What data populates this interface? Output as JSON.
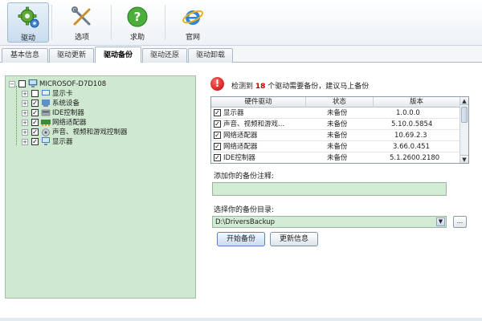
{
  "toolbar": {
    "items": [
      {
        "label": "驱动",
        "icon": "gear-icon",
        "active": true
      },
      {
        "label": "选项",
        "icon": "tools-icon",
        "active": false
      },
      {
        "label": "求助",
        "icon": "help-icon",
        "active": false
      },
      {
        "label": "官网",
        "icon": "ie-icon",
        "active": false
      }
    ]
  },
  "tabs": [
    {
      "label": "基本信息",
      "active": false
    },
    {
      "label": "驱动更新",
      "active": false
    },
    {
      "label": "驱动备份",
      "active": true
    },
    {
      "label": "驱动还原",
      "active": false
    },
    {
      "label": "驱动卸载",
      "active": false
    }
  ],
  "tree": {
    "root": {
      "label": "MICROSOF-D7D108",
      "checked": false
    },
    "children": [
      {
        "label": "显示卡",
        "checked": false,
        "icon": "display-adapter-icon"
      },
      {
        "label": "系统设备",
        "checked": true,
        "icon": "system-device-icon"
      },
      {
        "label": "IDE控制器",
        "checked": true,
        "icon": "ide-controller-icon"
      },
      {
        "label": "网络适配器",
        "checked": true,
        "icon": "network-adapter-icon"
      },
      {
        "label": "声音、视频和游戏控制器",
        "checked": true,
        "icon": "sound-icon"
      },
      {
        "label": "显示器",
        "checked": true,
        "icon": "monitor-icon"
      }
    ]
  },
  "alert": {
    "prefix": "检测到",
    "count": "18",
    "suffix": "个驱动需要备份，建议马上备份"
  },
  "grid": {
    "headers": [
      "硬件驱动",
      "状态",
      "版本"
    ],
    "rows": [
      {
        "name": "显示器",
        "status": "未备份",
        "version": "1.0.0.0"
      },
      {
        "name": "声音、视频和游戏...",
        "status": "未备份",
        "version": "5.10.0.5854"
      },
      {
        "name": "网络适配器",
        "status": "未备份",
        "version": "10.69.2.3"
      },
      {
        "name": "网络适配器",
        "status": "未备份",
        "version": "3.66.0.451"
      },
      {
        "name": "IDE控制器",
        "status": "未备份",
        "version": "5.1.2600.2180"
      }
    ]
  },
  "note": {
    "label": "添加你的备份注释:",
    "value": ""
  },
  "directory": {
    "label": "选择你的备份目录:",
    "value": "D:\\DriversBackup",
    "browse_label": "..."
  },
  "buttons": {
    "start_backup": "开始备份",
    "refresh": "更新信息"
  },
  "colors": {
    "panel_green": "#cfe8d0",
    "alert_red": "#c00000"
  }
}
